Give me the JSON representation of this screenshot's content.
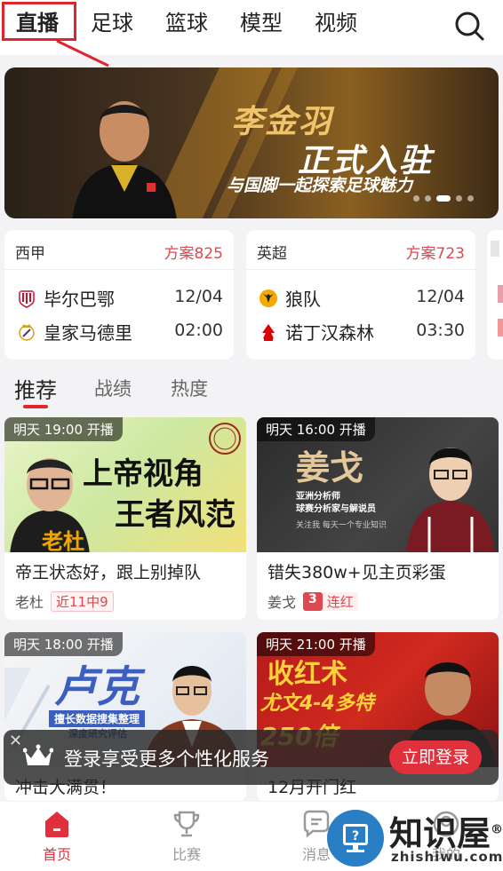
{
  "top_tabs": [
    "直播",
    "足球",
    "篮球",
    "模型",
    "视频"
  ],
  "active_top_tab": "直播",
  "banner": {
    "title_line1": "李金羽",
    "title_line2": "正式入驻",
    "subtitle": "与国脚一起探索足球魅力",
    "page_count": 5,
    "active_page": 3
  },
  "matches": [
    {
      "league": "西甲",
      "plans": "方案825",
      "home_team": "毕尔巴鄂",
      "away_team": "皇家马德里",
      "date": "12/04",
      "time": "02:00"
    },
    {
      "league": "英超",
      "plans": "方案723",
      "home_team": "狼队",
      "away_team": "诺丁汉森林",
      "date": "12/04",
      "time": "03:30"
    }
  ],
  "sub_tabs": [
    "推荐",
    "战绩",
    "热度"
  ],
  "active_sub_tab": "推荐",
  "cards": [
    {
      "time_badge": "明天 19:00 开播",
      "thumb_line1": "上帝视角",
      "thumb_line2": "王者风范",
      "thumb_name": "老杜",
      "title": "帝王状态好，跟上别掉队",
      "author": "老杜",
      "tag": "近11中9"
    },
    {
      "time_badge": "明天 16:00 开播",
      "thumb_line1": "姜戈",
      "thumb_sub1": "亚洲分析师",
      "thumb_sub2": "球赛分析家与解说员",
      "thumb_sub3": "关注我 每天一个专业知识",
      "title": "错失380w+见主页彩蛋",
      "author": "姜戈",
      "streak_num": "3",
      "streak_text": "连红"
    },
    {
      "time_badge": "明天 18:00 开播",
      "thumb_line1": "卢克",
      "thumb_sub1": "擅长数据搜集整理",
      "thumb_sub2": "深度研究评估",
      "title": "冲击大满贯！"
    },
    {
      "time_badge": "明天 21:00 开播",
      "thumb_line1": "收红术",
      "thumb_line2": "尤文4-4多特",
      "thumb_line3": "250倍",
      "title": "12月开门红"
    }
  ],
  "login_bar": {
    "close": "✕",
    "text": "登录享受更多个性化服务",
    "button": "立即登录"
  },
  "bottom_nav": [
    "首页",
    "比赛",
    "消息",
    "我的"
  ],
  "active_bottom_nav": "首页",
  "watermark": {
    "title": "知识屋",
    "registered": "®",
    "url": "zhishiwu.com"
  },
  "colors": {
    "accent": "#e0303b",
    "plan_red": "#e0474f"
  }
}
